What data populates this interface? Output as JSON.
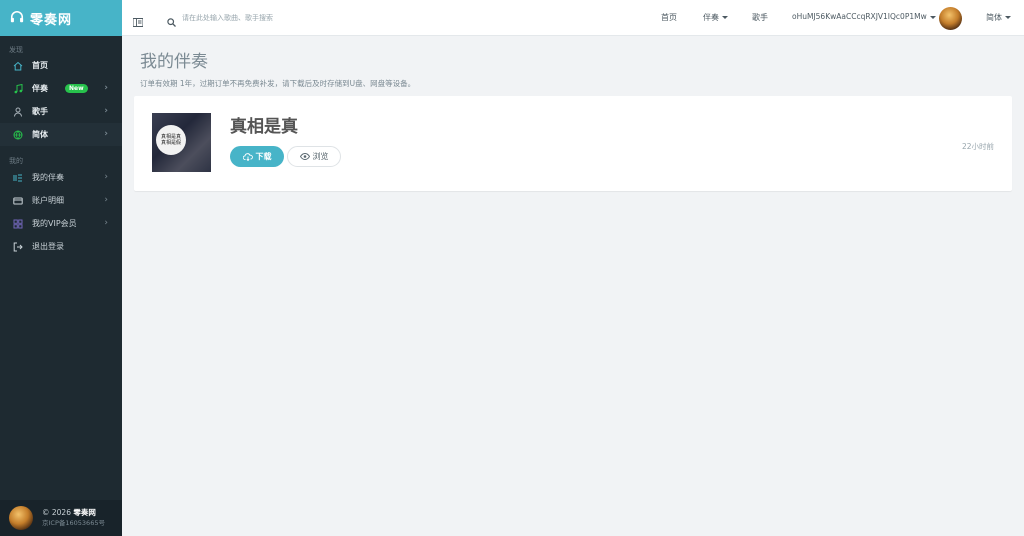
{
  "brand": {
    "name": "零奏网"
  },
  "sidebar": {
    "section_discover": "发现",
    "discover_items": [
      {
        "label": "首页",
        "icon": "home-icon"
      },
      {
        "label": "伴奏",
        "icon": "music-note-icon",
        "badge": "New"
      },
      {
        "label": "歌手",
        "icon": "singer-icon"
      },
      {
        "label": "简体",
        "icon": "globe-icon"
      }
    ],
    "section_mine": "我的",
    "mine_items": [
      {
        "label": "我的伴奏",
        "icon": "list-icon"
      },
      {
        "label": "账户明细",
        "icon": "card-icon"
      },
      {
        "label": "我的VIP会员",
        "icon": "grid-icon"
      },
      {
        "label": "退出登录",
        "icon": "logout-icon"
      }
    ],
    "footer": {
      "copyright": "© 2026",
      "site": "零奏网",
      "icp": "京ICP备16053665号"
    }
  },
  "header": {
    "search_placeholder": "请在此处输入歌曲、歌手搜索",
    "nav": {
      "home": "首页",
      "accompaniment": "伴奏",
      "singer": "歌手"
    },
    "username": "oHuMJ56KwAaCCcqRXJV1IQc0P1Mw",
    "language": "简体"
  },
  "main": {
    "title": "我的伴奏",
    "note": "订单有效期 1年，过期订单不再免费补发，请下载后及时存储到U盘、网盘等设备。",
    "items": [
      {
        "title": "真相是真",
        "cover_text_1": "真相是真",
        "cover_text_2": "真相是假",
        "download_label": "下载",
        "preview_label": "浏览",
        "time": "22小时前"
      }
    ]
  },
  "colors": {
    "accent": "#47b4c8",
    "sidebar": "#1e2a31",
    "badge": "#27c24c"
  }
}
